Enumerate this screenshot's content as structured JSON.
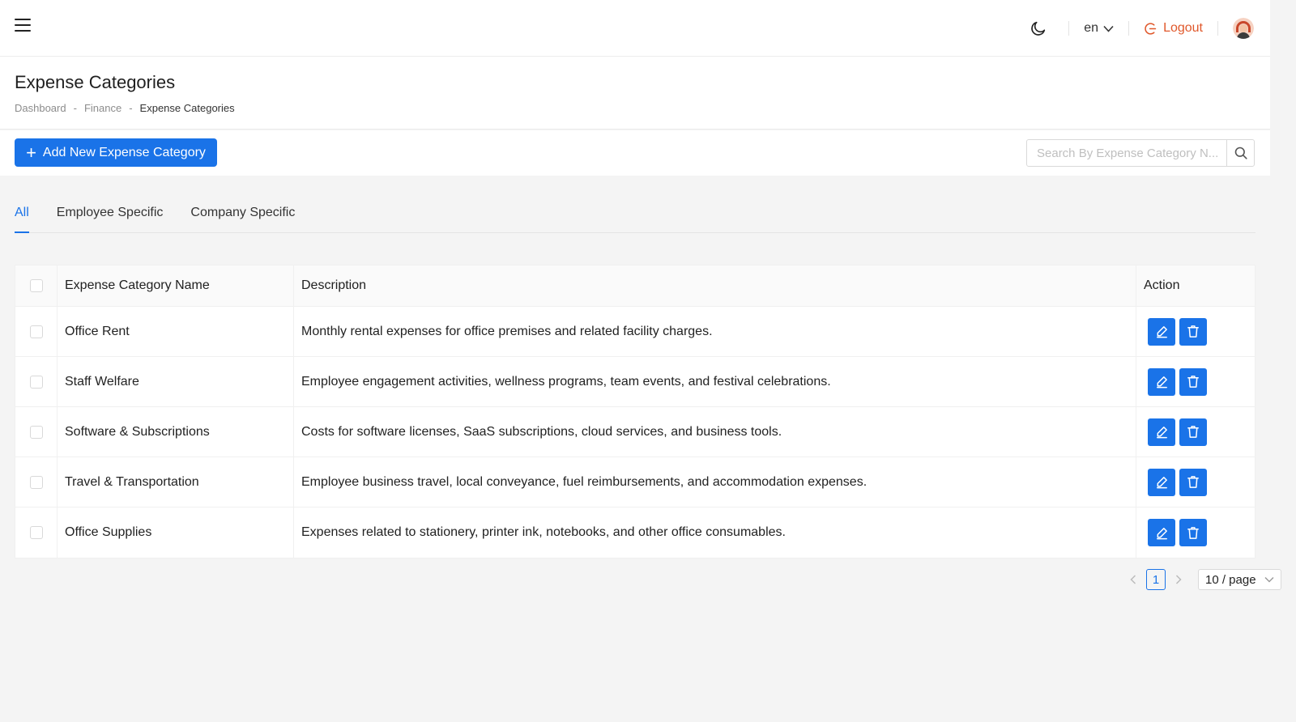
{
  "header": {
    "language": "en",
    "logout_label": "Logout"
  },
  "page": {
    "title": "Expense Categories",
    "breadcrumb": [
      "Dashboard",
      "Finance",
      "Expense Categories"
    ]
  },
  "toolbar": {
    "add_label": "Add New Expense Category",
    "search_placeholder": "Search By Expense Category N..."
  },
  "tabs": [
    "All",
    "Employee Specific",
    "Company Specific"
  ],
  "active_tab": "All",
  "table": {
    "columns": [
      "Expense Category Name",
      "Description",
      "Action"
    ],
    "rows": [
      {
        "name": "Office Rent",
        "description": "Monthly rental expenses for office premises and related facility charges."
      },
      {
        "name": "Staff Welfare",
        "description": "Employee engagement activities, wellness programs, team events, and festival celebrations."
      },
      {
        "name": "Software & Subscriptions",
        "description": "Costs for software licenses, SaaS subscriptions, cloud services, and business tools."
      },
      {
        "name": "Travel & Transportation",
        "description": "Employee business travel, local conveyance, fuel reimbursements, and accommodation expenses."
      },
      {
        "name": "Office Supplies",
        "description": "Expenses related to stationery, printer ink, notebooks, and other office consumables."
      }
    ]
  },
  "pagination": {
    "current_page": "1",
    "page_size": "10 / page"
  },
  "icons": {
    "menu": "hamburger-icon",
    "theme": "moon-icon",
    "logout": "logout-icon",
    "search": "search-icon",
    "edit": "edit-icon",
    "delete": "trash-icon"
  },
  "colors": {
    "primary": "#1a73e8",
    "logout": "#e0582b",
    "background": "#f4f4f4"
  }
}
